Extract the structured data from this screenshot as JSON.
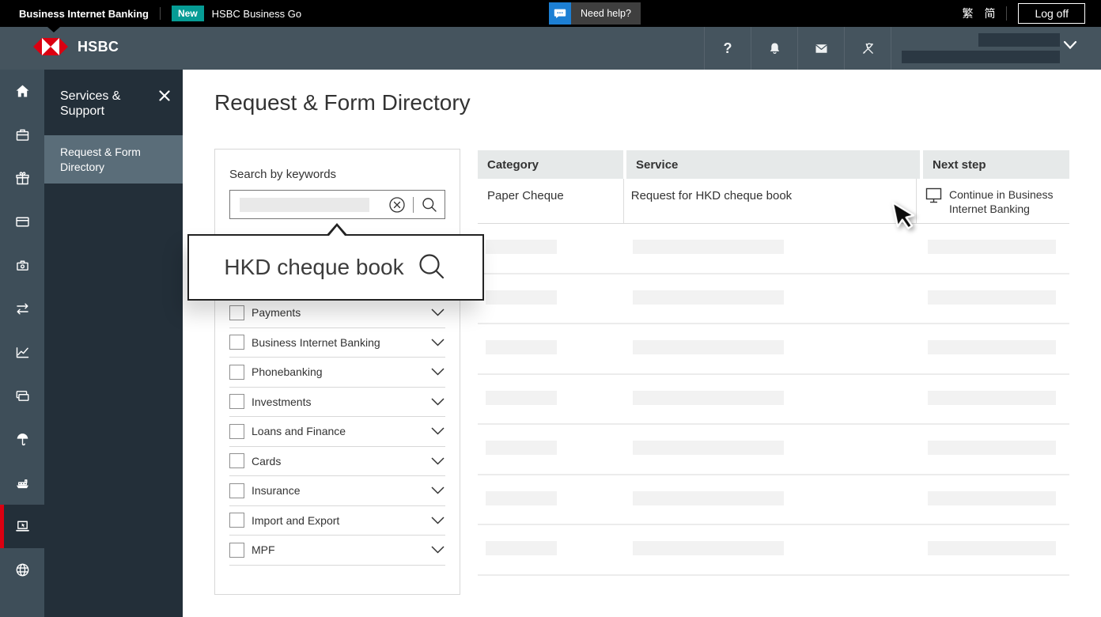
{
  "topbar": {
    "product": "Business Internet Banking",
    "new_badge": "New",
    "business_go": "HSBC Business Go",
    "need_help": "Need help?",
    "lang_traditional": "繁",
    "lang_simplified": "简",
    "log_off": "Log off"
  },
  "header": {
    "brand": "HSBC",
    "icons": [
      "help",
      "bell",
      "mail",
      "tools"
    ],
    "account_chevron": "chevron-down"
  },
  "sidebar": {
    "rail": [
      {
        "name": "home",
        "selected": false
      },
      {
        "name": "briefcase",
        "selected": false
      },
      {
        "name": "gift",
        "selected": false
      },
      {
        "name": "card",
        "selected": false
      },
      {
        "name": "deposit-box",
        "selected": false
      },
      {
        "name": "transfers",
        "selected": false
      },
      {
        "name": "chart",
        "selected": false
      },
      {
        "name": "cards",
        "selected": false
      },
      {
        "name": "umbrella",
        "selected": false
      },
      {
        "name": "ship",
        "selected": false
      },
      {
        "name": "laptop",
        "selected": true
      },
      {
        "name": "globe",
        "selected": false
      }
    ],
    "menu_title": "Services & Support",
    "menu_items": [
      {
        "label": "Request & Form Directory",
        "selected": true
      }
    ]
  },
  "main": {
    "title": "Request & Form Directory",
    "search": {
      "label": "Search by keywords",
      "tooltip_text": "HKD cheque book"
    },
    "filters": [
      "Payments",
      "Business Internet Banking",
      "Phonebanking",
      "Investments",
      "Loans and Finance",
      "Cards",
      "Insurance",
      "Import and Export",
      "MPF"
    ],
    "table": {
      "columns": [
        "Category",
        "Service",
        "Next step"
      ],
      "rows": [
        {
          "category": "Paper Cheque",
          "service": "Request for HKD cheque book",
          "next_step": "Continue in Business Internet Banking",
          "next_step_icon": "monitor"
        }
      ],
      "skeleton_rows": 7
    }
  },
  "colors": {
    "brand_red": "#db0011",
    "teal_badge": "#069c95",
    "header_bg": "#45545e",
    "rail_bg": "#3e4e59",
    "submenu_bg": "#232f39",
    "selected_menu_item_bg": "#5a6d79",
    "help_icon_blue": "#1c7fd4",
    "table_header_bg": "#e6e9e9",
    "skeleton_bar": "#f2f2f2"
  }
}
